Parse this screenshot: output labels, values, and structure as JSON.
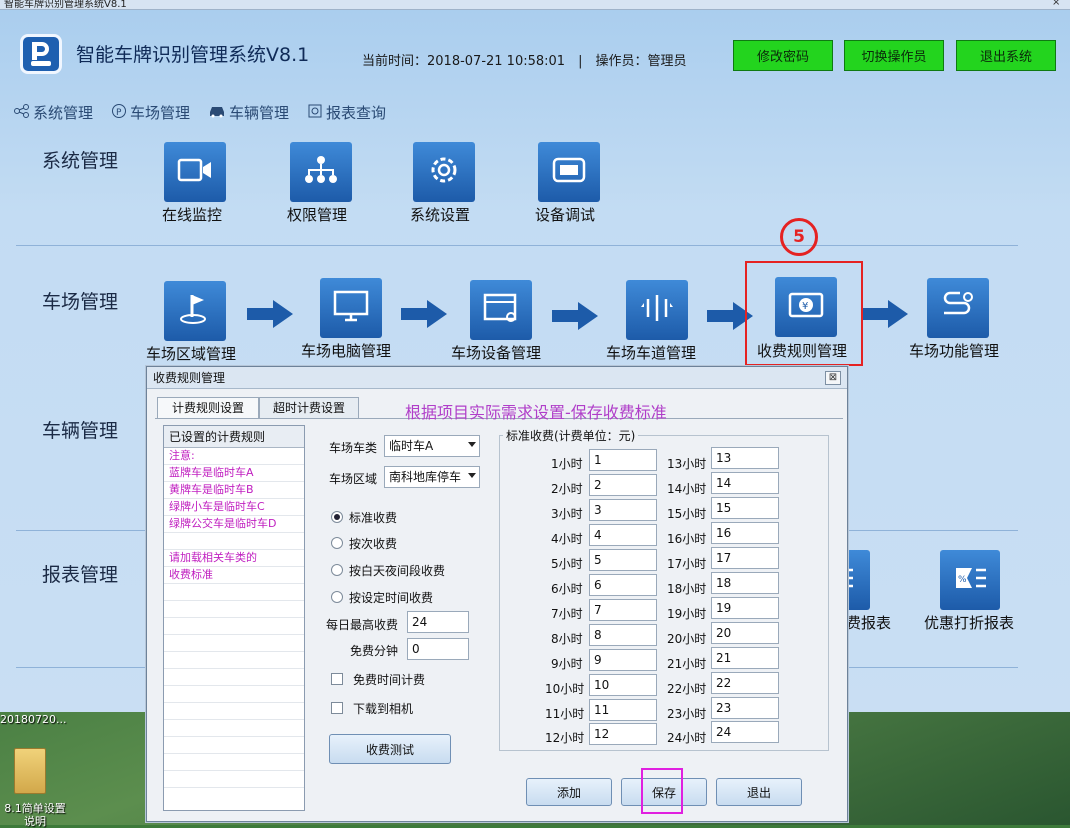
{
  "window": {
    "title": "智能车牌识别管理系统V8.1",
    "close": "×"
  },
  "header": {
    "app_name": "智能车牌识别管理系统V8.1",
    "current_time": "当前时间：2018-07-21 10:58:01　|　操作员：管理员",
    "btn_change_pwd": "修改密码",
    "btn_switch_op": "切换操作员",
    "btn_exit": "退出系统"
  },
  "nav": {
    "items": [
      "系统管理",
      "车场管理",
      "车辆管理",
      "报表查询"
    ]
  },
  "sections": {
    "system": {
      "title": "系统管理",
      "tiles": [
        "在线监控",
        "权限管理",
        "系统设置",
        "设备调试"
      ]
    },
    "parking": {
      "title": "车场管理",
      "tiles": [
        "车场区域管理",
        "车场电脑管理",
        "车场设备管理",
        "车场车道管理",
        "收费规则管理",
        "车场功能管理"
      ]
    },
    "vehicle": {
      "title": "车辆管理"
    },
    "report": {
      "title": "报表管理",
      "tiles": [
        "费报表",
        "优惠打折报表"
      ]
    }
  },
  "step_marker": "5",
  "dialog": {
    "title": "收费规则管理",
    "close": "⊠",
    "tabs": [
      "计费规则设置",
      "超时计费设置"
    ],
    "banner": "根据项目实际需求设置-保存收费标准",
    "rule_list": {
      "header": "已设置的计费规则",
      "lines": [
        "注意:",
        "蓝牌车是临时车A",
        "黄牌车是临时车B",
        "绿牌小车是临时车C",
        "绿牌公交车是临时车D",
        "",
        "请加载相关车类的",
        "收费标准"
      ]
    },
    "car_type_label": "车场车类",
    "car_type_value": "临时车A",
    "area_label": "车场区域",
    "area_value": "南科地库停车",
    "radios": [
      {
        "label": "标准收费",
        "checked": true
      },
      {
        "label": "按次收费",
        "checked": false
      },
      {
        "label": "按白天夜间段收费",
        "checked": false
      },
      {
        "label": "按设定时间收费",
        "checked": false
      }
    ],
    "daily_max_label": "每日最高收费",
    "daily_max_value": "24",
    "free_min_label": "免费分钟",
    "free_min_value": "0",
    "chk_free_time": "免费时间计费",
    "chk_download": "下载到相机",
    "btn_test": "收费测试",
    "std_title": "标准收费(计费单位：元)",
    "hours_left": [
      {
        "label": "1小时",
        "value": "1"
      },
      {
        "label": "2小时",
        "value": "2"
      },
      {
        "label": "3小时",
        "value": "3"
      },
      {
        "label": "4小时",
        "value": "4"
      },
      {
        "label": "5小时",
        "value": "5"
      },
      {
        "label": "6小时",
        "value": "6"
      },
      {
        "label": "7小时",
        "value": "7"
      },
      {
        "label": "8小时",
        "value": "8"
      },
      {
        "label": "9小时",
        "value": "9"
      },
      {
        "label": "10小时",
        "value": "10"
      },
      {
        "label": "11小时",
        "value": "11"
      },
      {
        "label": "12小时",
        "value": "12"
      }
    ],
    "hours_right": [
      {
        "label": "13小时",
        "value": "13"
      },
      {
        "label": "14小时",
        "value": "14"
      },
      {
        "label": "15小时",
        "value": "15"
      },
      {
        "label": "16小时",
        "value": "16"
      },
      {
        "label": "17小时",
        "value": "17"
      },
      {
        "label": "18小时",
        "value": "18"
      },
      {
        "label": "19小时",
        "value": "19"
      },
      {
        "label": "20小时",
        "value": "20"
      },
      {
        "label": "21小时",
        "value": "21"
      },
      {
        "label": "22小时",
        "value": "22"
      },
      {
        "label": "23小时",
        "value": "23"
      },
      {
        "label": "24小时",
        "value": "24"
      }
    ],
    "btn_add": "添加",
    "btn_save": "保存",
    "btn_exit": "退出"
  },
  "desktop": {
    "date_text": "20180720...",
    "icon_label": "8.1简单设置说明"
  },
  "colors": {
    "accent_green": "#23d41e",
    "tile_blue": "#1d5ba9",
    "highlight_red": "#e52222",
    "note_pink": "#c020c0",
    "banner_purple": "#b03ec9"
  }
}
